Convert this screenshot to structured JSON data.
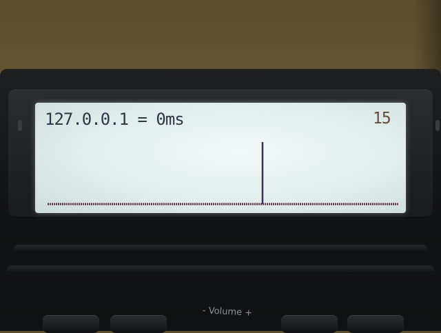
{
  "lcd": {
    "ping_text": "127.0.0.1 = 0ms",
    "counter": "15",
    "ping_history_ms": [
      0
    ],
    "colors": {
      "text": "#2f3744",
      "counter": "#6a4a3a",
      "graph_line": "#3a2f5a",
      "baseline": "#5a3042"
    }
  },
  "device": {
    "volume_label": "- Volume +"
  }
}
